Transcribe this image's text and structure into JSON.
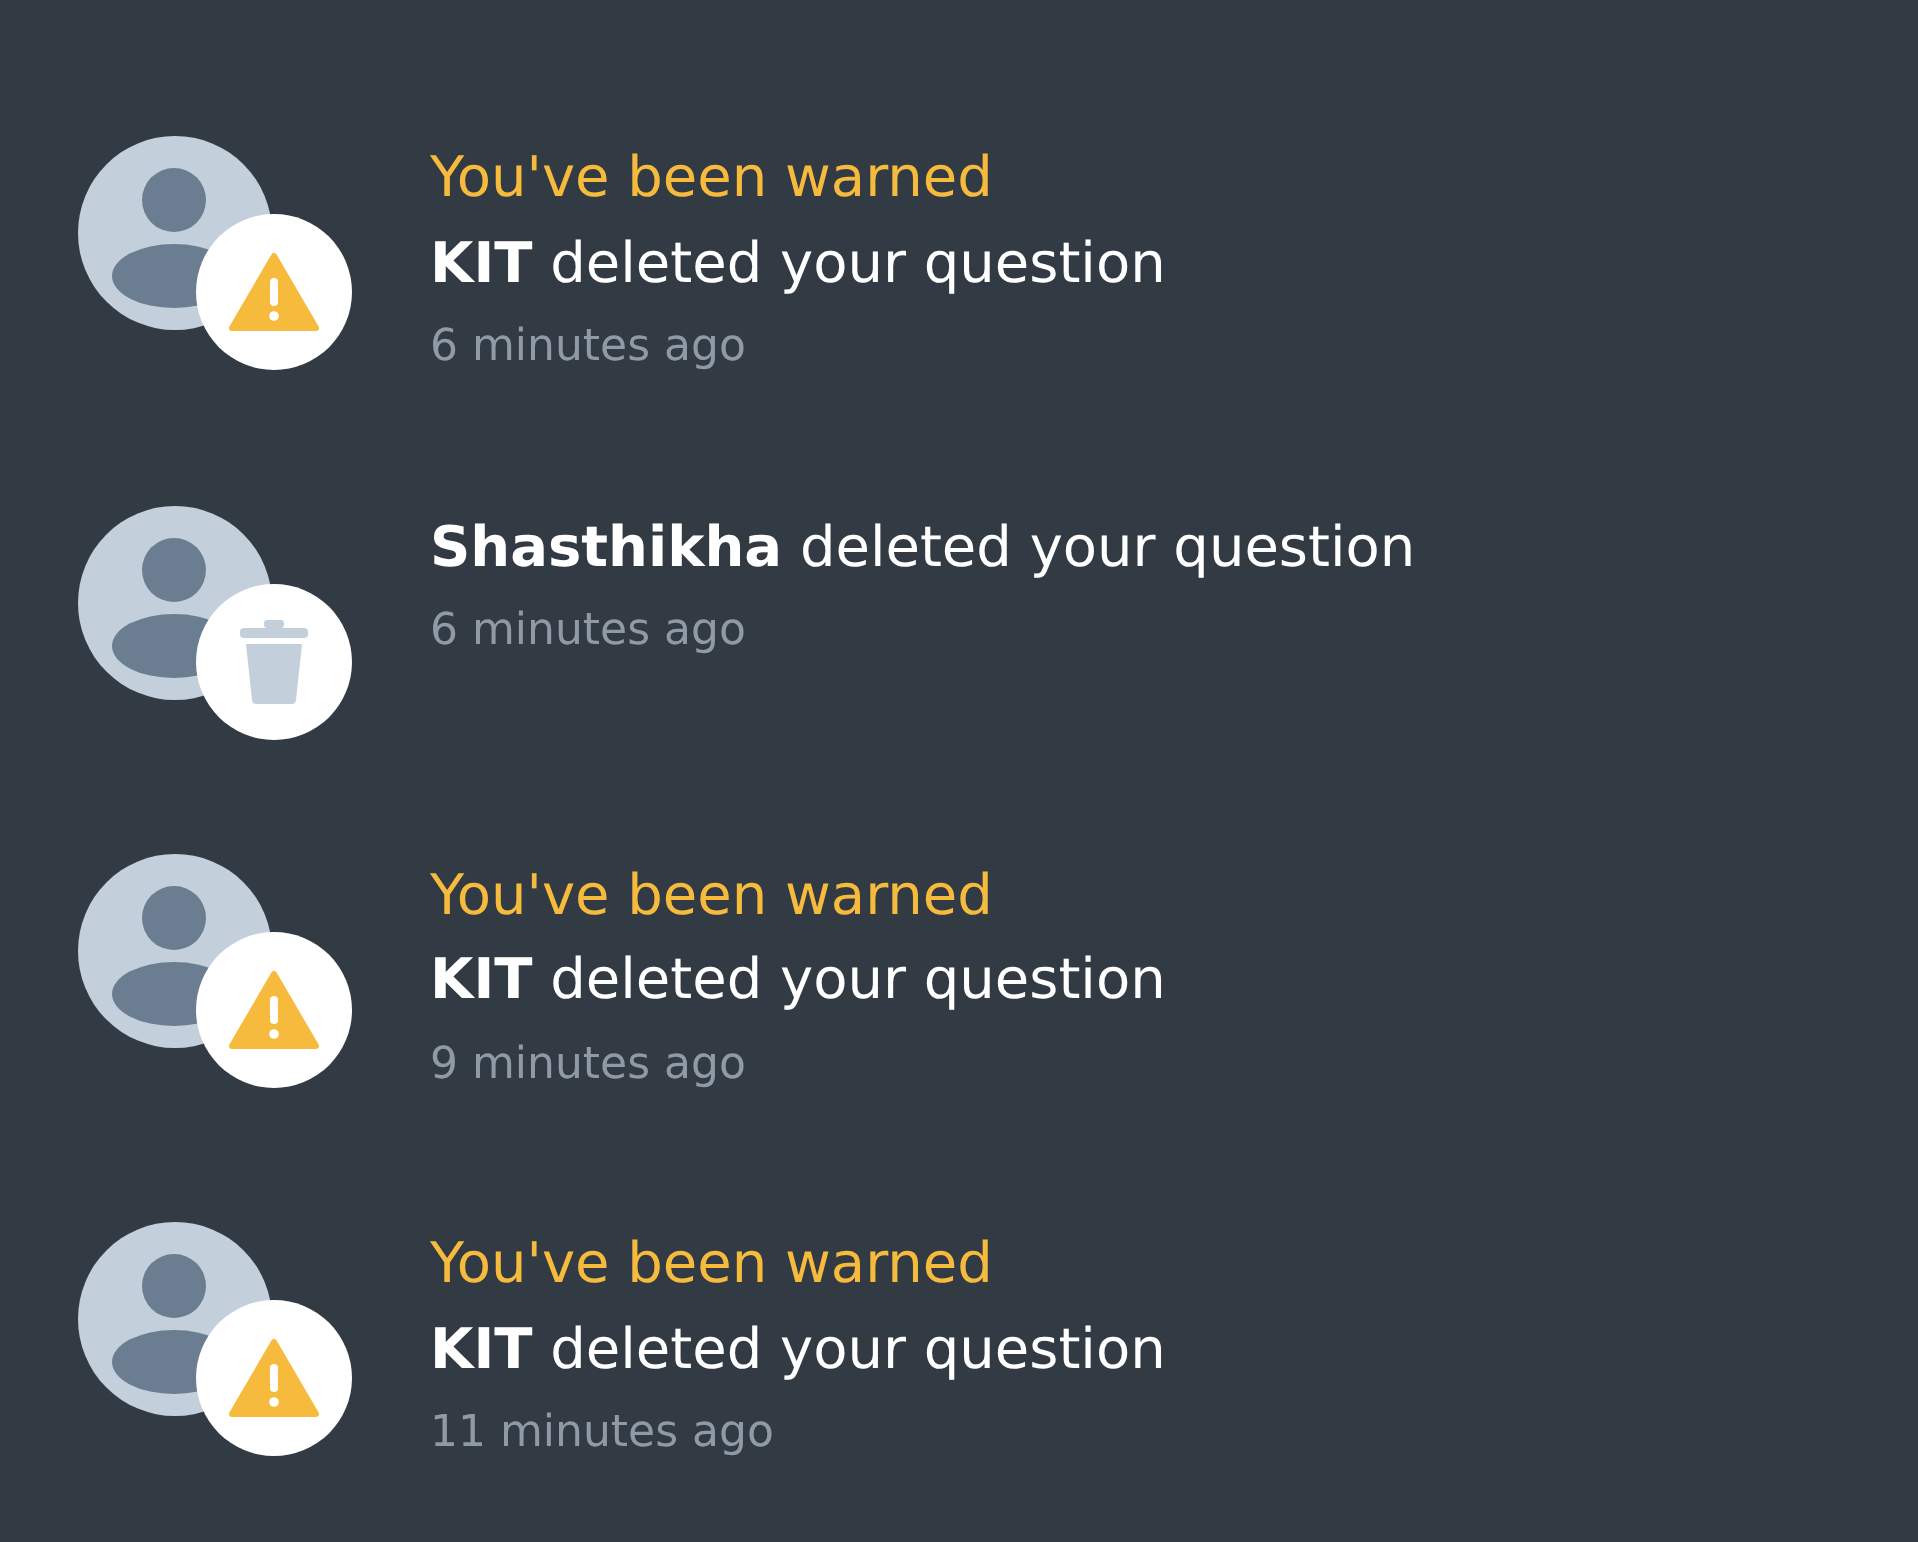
{
  "notifications": [
    {
      "kind": "warning",
      "warning": "You've been warned",
      "user": "KIT",
      "action": "deleted your question",
      "time": "6 minutes ago"
    },
    {
      "kind": "deletion",
      "user": "Shasthikha",
      "action": "deleted your question",
      "time": "6 minutes ago"
    },
    {
      "kind": "warning",
      "warning": "You've been warned",
      "user": "KIT",
      "action": "deleted your question",
      "time": "9 minutes ago"
    },
    {
      "kind": "warning",
      "warning": "You've been warned",
      "user": "KIT",
      "action": "deleted your question",
      "time": "11 minutes ago"
    }
  ]
}
